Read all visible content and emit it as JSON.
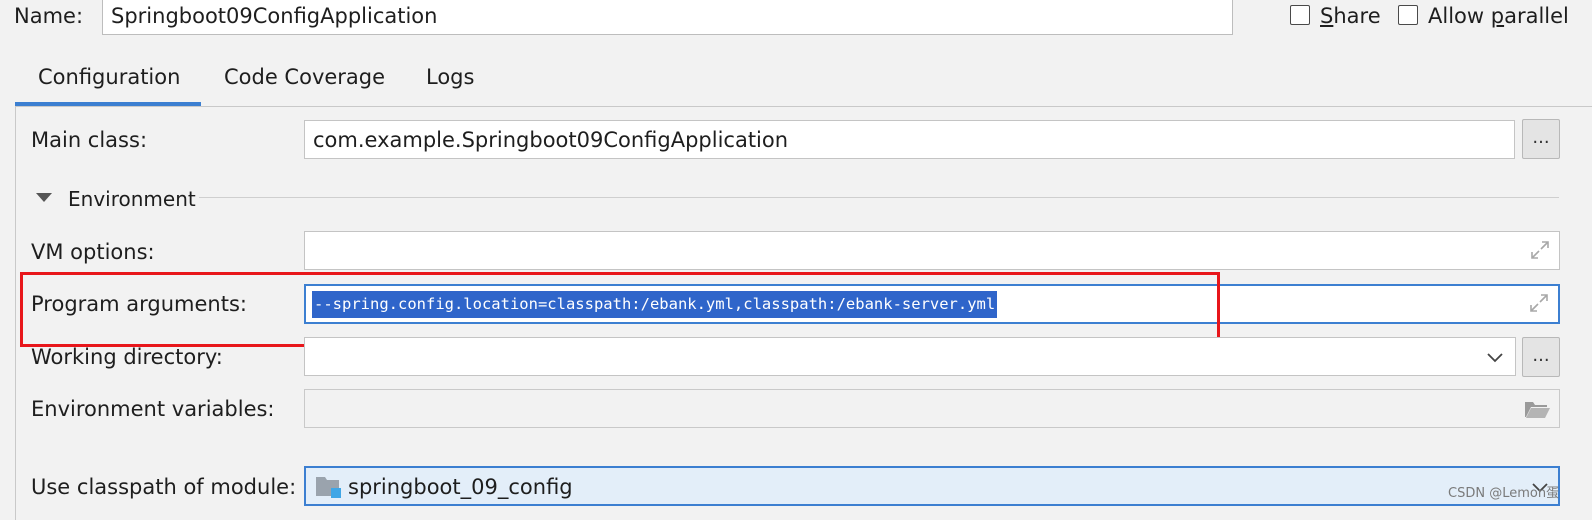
{
  "header": {
    "name_label": "Name:",
    "name_value": "Springboot09ConfigApplication",
    "share_prefix": "",
    "share_mnemonic": "S",
    "share_rest": "hare",
    "allow_prefix": "Allow ",
    "allow_mnemonic": "p",
    "allow_rest": "arallel",
    "share_checked": false,
    "allow_parallel_checked": false
  },
  "tabs": [
    {
      "label": "Configuration",
      "active": true
    },
    {
      "label": "Code Coverage",
      "active": false
    },
    {
      "label": "Logs",
      "active": false
    }
  ],
  "form": {
    "main_class_label": "Main class:",
    "main_class_value": "com.example.Springboot09ConfigApplication",
    "browse_label": "...",
    "environment_label": "Environment",
    "vm_options_label": "VM options:",
    "vm_options_value": "",
    "program_arguments_label": "Program arguments:",
    "program_arguments_value": "--spring.config.location=classpath:/ebank.yml,classpath:/ebank-server.yml",
    "working_directory_label": "Working directory:",
    "working_directory_value": "",
    "env_variables_label": "Environment variables:",
    "env_variables_value": "",
    "classpath_module_label": "Use classpath of module:",
    "classpath_module_value": "springboot_09_config"
  },
  "watermark": "CSDN @Lemon蛋",
  "colors": {
    "accent": "#3c7fd1",
    "highlight_box": "#e8161b",
    "selection": "#2f65ca"
  },
  "icons": [
    "expand-icon",
    "folder-icon",
    "chevron-down-icon",
    "module-icon",
    "triangle-down-icon"
  ]
}
